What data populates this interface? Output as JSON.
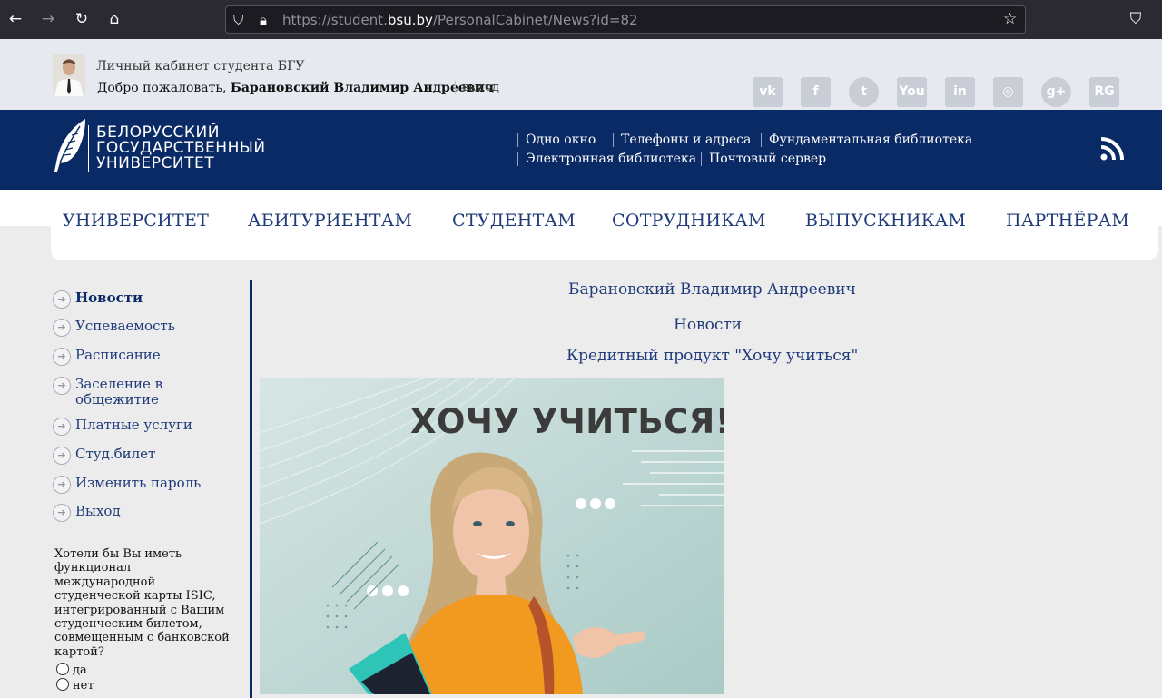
{
  "browser": {
    "url_prefix": "https://student.",
    "url_domain": "bsu.by",
    "url_path": "/PersonalCabinet/News?id=82"
  },
  "topbar": {
    "cabinet_title": "Личный кабинет студента БГУ",
    "welcome_prefix": "Добро пожаловать,",
    "user_name": "Барановский Владимир Андреевич",
    "logout": "выход",
    "social": [
      {
        "icon": "vk-icon",
        "glyph": "vk"
      },
      {
        "icon": "facebook-icon",
        "glyph": "f"
      },
      {
        "icon": "twitter-icon",
        "glyph": "t"
      },
      {
        "icon": "youtube-icon",
        "glyph": "You"
      },
      {
        "icon": "linkedin-icon",
        "glyph": "in"
      },
      {
        "icon": "instagram-icon",
        "glyph": "◎"
      },
      {
        "icon": "googleplus-icon",
        "glyph": "g+"
      },
      {
        "icon": "researchgate-icon",
        "glyph": "RG"
      }
    ]
  },
  "header": {
    "logo_line1": "БЕЛОРУССКИЙ",
    "logo_line2": "ГОСУДАРСТВЕННЫЙ",
    "logo_line3": "УНИВЕРСИТЕТ",
    "links": [
      "Одно окно",
      "Телефоны и адреса",
      "Фундаментальная библиотека",
      "Электронная библиотека",
      "Почтовый сервер"
    ]
  },
  "menu": [
    "УНИВЕРСИТЕТ",
    "АБИТУРИЕНТАМ",
    "СТУДЕНТАМ",
    "СОТРУДНИКАМ",
    "ВЫПУСКНИКАМ",
    "ПАРТНЁРАМ"
  ],
  "sidebar": {
    "items": [
      "Новости",
      "Успеваемость",
      "Расписание",
      "Заселение в общежитие",
      "Платные услуги",
      "Студ.билет",
      "Изменить пароль",
      "Выход"
    ],
    "active_index": 0
  },
  "poll": {
    "question": "Хотели бы Вы иметь функционал международной студенческой карты ISIC, интегрированный с Вашим студенческим билетом, совмещенным с банковской картой?",
    "options": [
      "да",
      "нет"
    ]
  },
  "content": {
    "student_name": "Барановский Владимир Андреевич",
    "section": "Новости",
    "news_title": "Кредитный продукт \"Хочу учиться\"",
    "banner_text": "ХОЧУ УЧИТЬСЯ!"
  },
  "colors": {
    "brand_dark": "#0a2a66",
    "link": "#1f3b7a",
    "page_bg": "#ececec"
  }
}
